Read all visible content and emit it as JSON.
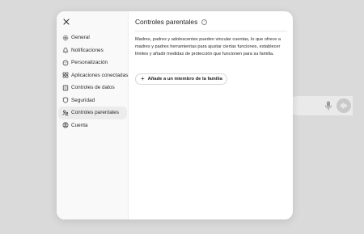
{
  "dialog": {
    "close_label": "✕"
  },
  "sidebar": {
    "items": [
      {
        "label": "General",
        "icon": "gear-icon",
        "active": false
      },
      {
        "label": "Notificaciones",
        "icon": "bell-icon",
        "active": false
      },
      {
        "label": "Personalización",
        "icon": "personalization-icon",
        "active": false
      },
      {
        "label": "Aplicaciones conectadas",
        "icon": "apps-icon",
        "active": false
      },
      {
        "label": "Controles de datos",
        "icon": "data-controls-icon",
        "active": false
      },
      {
        "label": "Seguridad",
        "icon": "shield-icon",
        "active": false
      },
      {
        "label": "Controles parentales",
        "icon": "family-icon",
        "active": true
      },
      {
        "label": "Cuenta",
        "icon": "account-icon",
        "active": false
      }
    ]
  },
  "main": {
    "title": "Controles parentales",
    "description": "Madres, padres y adolescentes pueden vincular cuentas, lo que ofrece a madres y padres herramientas para ajustar ciertas funciones, establecer límites y añadir medidas de protección que funcionen para su familia.",
    "add_member_label": "Añade a un miembro de la familia"
  },
  "colors": {
    "backdrop": "#dadada",
    "sidebar_bg": "#f9f9f9",
    "active_item_bg": "#ececec",
    "dialog_bg": "#ffffff"
  }
}
